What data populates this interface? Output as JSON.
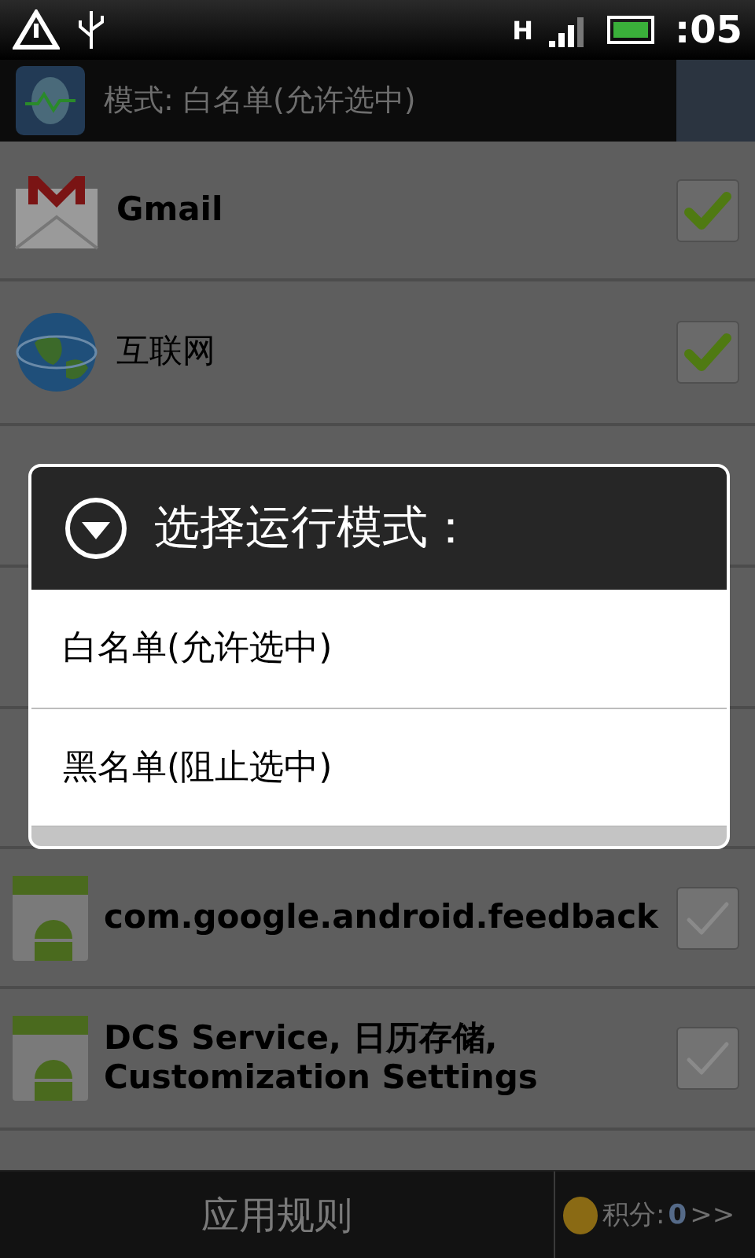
{
  "status_bar": {
    "time": ":05",
    "network": "H"
  },
  "header": {
    "title": "模式: 白名单(允许选中)"
  },
  "apps": [
    {
      "name": "Gmail",
      "kind": "mail",
      "checked": true,
      "bold": true
    },
    {
      "name": "互联网",
      "kind": "globe",
      "checked": true,
      "bold": false
    },
    {
      "kind": "hidden"
    },
    {
      "kind": "hidden"
    },
    {
      "kind": "hidden"
    },
    {
      "name": "com.google.android.feedback",
      "kind": "android",
      "checked": false,
      "bold": true
    },
    {
      "name": "DCS Service, 日历存储, Customization Settings",
      "kind": "android",
      "checked": false,
      "bold": true
    }
  ],
  "dialog": {
    "title": "选择运行模式：",
    "options": [
      {
        "label": "白名单(允许选中)"
      },
      {
        "label": "黑名单(阻止选中)"
      }
    ]
  },
  "bottom_bar": {
    "button": "应用规则",
    "points_label": "积分:",
    "points": "0",
    "more": ">>"
  }
}
